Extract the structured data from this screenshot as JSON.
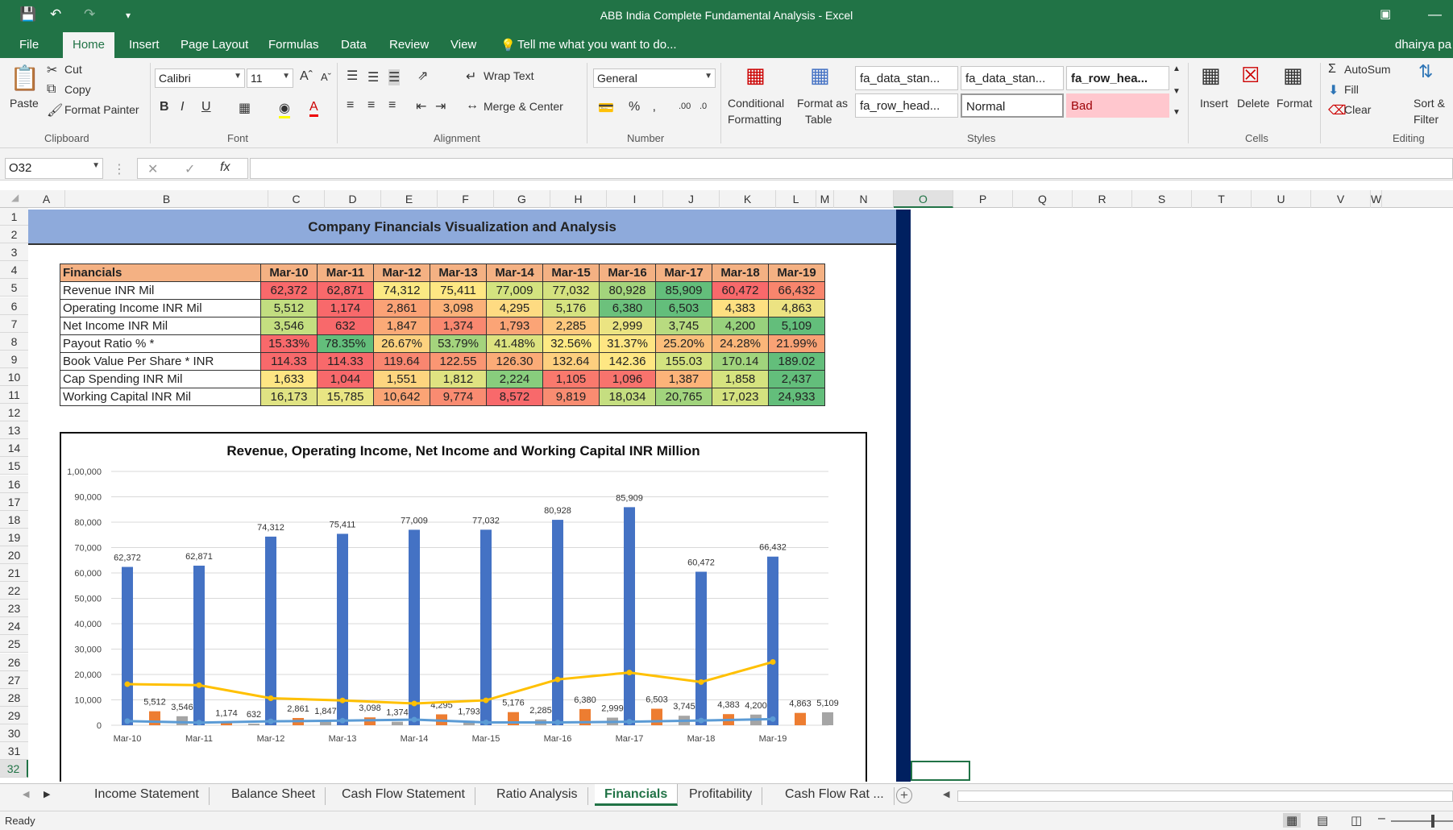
{
  "window": {
    "title": "ABB India Complete Fundamental Analysis - Excel",
    "user": "dhairya pa"
  },
  "ribbon_tabs": [
    "File",
    "Home",
    "Insert",
    "Page Layout",
    "Formulas",
    "Data",
    "Review",
    "View"
  ],
  "tell_me": "Tell me what you want to do...",
  "clipboard": {
    "paste": "Paste",
    "cut": "Cut",
    "copy": "Copy",
    "format_painter": "Format Painter",
    "group": "Clipboard"
  },
  "font": {
    "name": "Calibri",
    "size": "11",
    "group": "Font"
  },
  "alignment": {
    "wrap": "Wrap Text",
    "merge": "Merge & Center",
    "group": "Alignment"
  },
  "number": {
    "format": "General",
    "group": "Number"
  },
  "styles": {
    "conditional": "Conditional",
    "formatting": "Formatting",
    "format_as": "Format as",
    "table": "Table",
    "cells": [
      "fa_data_stan...",
      "fa_data_stan...",
      "fa_row_hea...",
      "fa_row_head...",
      "Normal",
      "Bad"
    ],
    "group": "Styles"
  },
  "cells_grp": {
    "insert": "Insert",
    "delete": "Delete",
    "format": "Format",
    "group": "Cells"
  },
  "editing": {
    "autosum": "AutoSum",
    "fill": "Fill",
    "clear": "Clear",
    "sort": "Sort &",
    "filter": "Filter",
    "group": "Editing"
  },
  "name_box": "O32",
  "columns": [
    "A",
    "B",
    "C",
    "D",
    "E",
    "F",
    "G",
    "H",
    "I",
    "J",
    "K",
    "L",
    "M",
    "N",
    "O",
    "P",
    "Q",
    "R",
    "S",
    "T",
    "U",
    "V",
    "W"
  ],
  "rows": [
    "1",
    "2",
    "3",
    "4",
    "5",
    "6",
    "7",
    "8",
    "9",
    "10",
    "11",
    "12",
    "13",
    "14",
    "15",
    "16",
    "17",
    "18",
    "19",
    "20",
    "21",
    "22",
    "23",
    "24",
    "25",
    "26",
    "27",
    "28",
    "29",
    "30",
    "31",
    "32"
  ],
  "banner_title": "Company Financials Visualization and Analysis",
  "table": {
    "header": [
      "Financials",
      "Mar-10",
      "Mar-11",
      "Mar-12",
      "Mar-13",
      "Mar-14",
      "Mar-15",
      "Mar-16",
      "Mar-17",
      "Mar-18",
      "Mar-19"
    ],
    "rows": [
      {
        "label": "Revenue INR Mil",
        "values": [
          "62,372",
          "62,871",
          "74,312",
          "75,411",
          "77,009",
          "77,032",
          "80,928",
          "85,909",
          "60,472",
          "66,432"
        ],
        "colors": [
          "#f8696b",
          "#f8696b",
          "#fbe983",
          "#fee783",
          "#d3e37f",
          "#d4e27f",
          "#a3d47c",
          "#63be7b",
          "#f8696b",
          "#f8856d"
        ]
      },
      {
        "label": "Operating Income INR Mil",
        "values": [
          "5,512",
          "1,174",
          "2,861",
          "3,098",
          "4,295",
          "5,176",
          "6,380",
          "6,503",
          "4,383",
          "4,863"
        ],
        "colors": [
          "#c2de80",
          "#f8696b",
          "#fba276",
          "#fbb179",
          "#fedb82",
          "#d5e380",
          "#6cc17c",
          "#63be7b",
          "#fee081",
          "#ece382"
        ],
        "note": "colors approximate heat map"
      },
      {
        "label": "Net Income INR Mil",
        "values": [
          "3,546",
          "632",
          "1,847",
          "1,374",
          "1,793",
          "2,285",
          "2,999",
          "3,745",
          "4,200",
          "5,109"
        ],
        "colors": [
          "#c4df80",
          "#f8696b",
          "#fbaa77",
          "#f98870",
          "#fba476",
          "#fdc97e",
          "#ebe482",
          "#b8db80",
          "#98d27d",
          "#63be7b"
        ]
      },
      {
        "label": "Payout Ratio % *",
        "values": [
          "15.33%",
          "78.35%",
          "26.67%",
          "53.79%",
          "41.48%",
          "32.56%",
          "31.37%",
          "25.20%",
          "24.28%",
          "21.99%"
        ],
        "colors": [
          "#f8696b",
          "#63be7b",
          "#fdd27f",
          "#a4d47d",
          "#dde380",
          "#feea83",
          "#fee683",
          "#fcbf7b",
          "#fbb679",
          "#f9a275"
        ]
      },
      {
        "label": "Book Value Per Share * INR",
        "values": [
          "114.33",
          "114.33",
          "119.64",
          "122.55",
          "126.30",
          "132.64",
          "142.36",
          "155.03",
          "170.14",
          "189.02"
        ],
        "colors": [
          "#f8696b",
          "#f8696b",
          "#f98670",
          "#fa9673",
          "#fbab77",
          "#fdcf7e",
          "#fee783",
          "#d3e37f",
          "#a1d47c",
          "#63be7b"
        ]
      },
      {
        "label": "Cap Spending INR Mil",
        "values": [
          "1,633",
          "1,044",
          "1,551",
          "1,812",
          "2,224",
          "1,105",
          "1,096",
          "1,387",
          "1,858",
          "2,437"
        ],
        "colors": [
          "#fee583",
          "#f8696b",
          "#fdd57f",
          "#dfe381",
          "#88cd7d",
          "#f9796d",
          "#f8736d",
          "#fcb379",
          "#d6e37f",
          "#63be7b"
        ]
      },
      {
        "label": "Working Capital INR Mil",
        "values": [
          "16,173",
          "15,785",
          "10,642",
          "9,774",
          "8,572",
          "9,819",
          "18,034",
          "20,765",
          "17,023",
          "24,933"
        ],
        "colors": [
          "#e0e383",
          "#e9e583",
          "#fba475",
          "#f98b71",
          "#f8696b",
          "#f98c71",
          "#c5de80",
          "#a1d47d",
          "#d4e27f",
          "#63be7b"
        ]
      }
    ]
  },
  "chart_data": {
    "type": "bar",
    "title": "Revenue, Operating Income, Net Income and Working Capital INR Million",
    "categories": [
      "Mar-10",
      "Mar-11",
      "Mar-12",
      "Mar-13",
      "Mar-14",
      "Mar-15",
      "Mar-16",
      "Mar-17",
      "Mar-18",
      "Mar-19"
    ],
    "ylim": [
      0,
      100000
    ],
    "yticks": [
      "0",
      "10,000",
      "20,000",
      "30,000",
      "40,000",
      "50,000",
      "60,000",
      "70,000",
      "80,000",
      "90,000",
      "1,00,000"
    ],
    "series": [
      {
        "values": [
          62372,
          62871,
          74312,
          75411,
          77009,
          77032,
          80928,
          85909,
          60472,
          66432
        ],
        "labels": [
          "62,372",
          "62,871",
          "74,312",
          "75,411",
          "77,009",
          "77,032",
          "80,928",
          "85,909",
          "60,472",
          "66,432"
        ],
        "color": "#4472c4",
        "kind": "bar"
      },
      {
        "values": [
          5512,
          1174,
          2861,
          3098,
          4295,
          5176,
          6380,
          6503,
          4383,
          4863
        ],
        "labels": [
          "5,512",
          "1,174",
          "2,861",
          "3,098",
          "4,295",
          "5,176",
          "6,380",
          "6,503",
          "4,383",
          "4,863"
        ],
        "color": "#ed7d31",
        "kind": "bar"
      },
      {
        "values": [
          3546,
          632,
          1847,
          1374,
          1793,
          2285,
          2999,
          3745,
          4200,
          5109
        ],
        "labels": [
          "3,546",
          "632",
          "1,847",
          "1,374",
          "1,793",
          "2,285",
          "2,999",
          "3,745",
          "4,200",
          "5,109"
        ],
        "color": "#a5a5a5",
        "kind": "bar"
      },
      {
        "values": [
          16173,
          15785,
          10642,
          9774,
          8572,
          9819,
          18034,
          20765,
          17023,
          24933
        ],
        "color": "#ffc000",
        "kind": "line"
      },
      {
        "values": [
          1633,
          1044,
          1551,
          1812,
          2224,
          1105,
          1096,
          1387,
          1858,
          2437
        ],
        "color": "#5b9bd5",
        "kind": "line"
      }
    ]
  },
  "sheet_tabs": [
    "Income Statement",
    "Balance Sheet",
    "Cash Flow Statement",
    "Ratio Analysis",
    "Financials",
    "Profitability",
    "Cash Flow Rat ..."
  ],
  "status": "Ready"
}
